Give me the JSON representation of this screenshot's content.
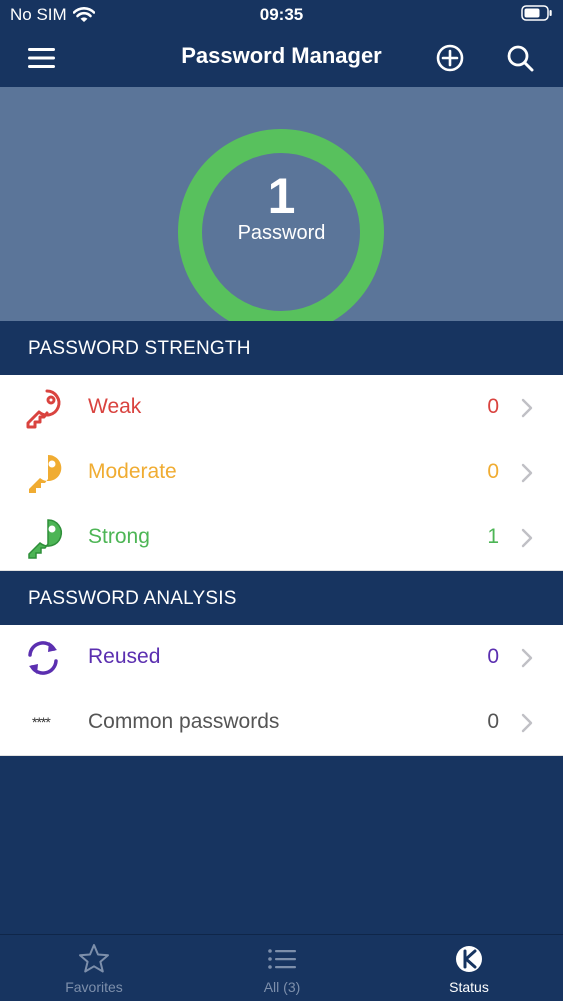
{
  "status_bar": {
    "carrier": "No SIM",
    "time": "09:35"
  },
  "nav": {
    "title": "Password Manager"
  },
  "summary": {
    "count": "1",
    "label": "Password",
    "ring_color": "#58c15d"
  },
  "sections": {
    "strength": {
      "title": "PASSWORD STRENGTH",
      "rows": [
        {
          "label": "Weak",
          "count": "0",
          "color": "#d9433f",
          "icon": "red-key-icon"
        },
        {
          "label": "Moderate",
          "count": "0",
          "color": "#f0ac32",
          "icon": "yellow-key-icon"
        },
        {
          "label": "Strong",
          "count": "1",
          "color": "#4db555",
          "icon": "green-key-icon"
        }
      ]
    },
    "analysis": {
      "title": "PASSWORD ANALYSIS",
      "rows": [
        {
          "label": "Reused",
          "count": "0",
          "color": "#5b2fb0",
          "icon": "refresh-icon"
        },
        {
          "label": "Common passwords",
          "count": "0",
          "color": "#555555",
          "icon": "asterisks-icon",
          "icon_text": "****"
        }
      ]
    }
  },
  "tabs": [
    {
      "label": "Favorites",
      "icon": "star-icon",
      "active": false
    },
    {
      "label": "All (3)",
      "icon": "list-icon",
      "active": false
    },
    {
      "label": "Status",
      "icon": "status-icon",
      "active": true
    }
  ]
}
